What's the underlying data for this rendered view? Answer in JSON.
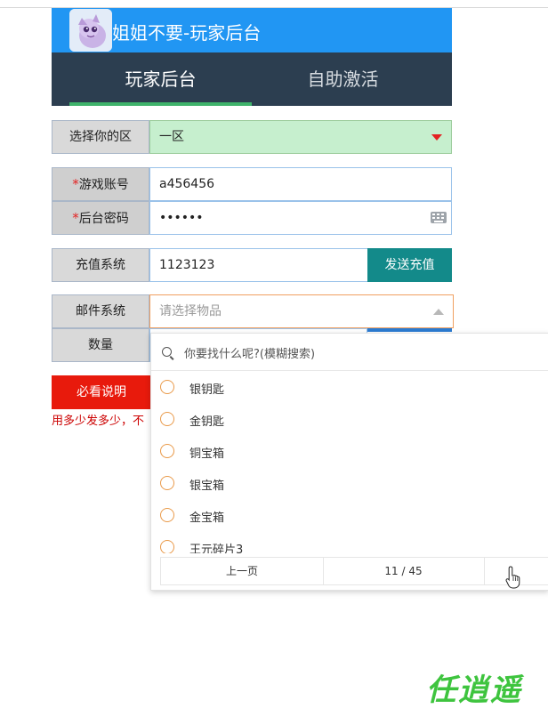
{
  "header": {
    "title": "姐姐不要-玩家后台",
    "avatar_icon": "pony-avatar-icon"
  },
  "tabs": [
    {
      "label": "玩家后台",
      "active": true
    },
    {
      "label": "自助激活",
      "active": false
    }
  ],
  "form": {
    "server": {
      "label": "选择你的区",
      "value": "一区"
    },
    "account": {
      "required_mark": "*",
      "label": "游戏账号",
      "value": "a456456"
    },
    "password": {
      "required_mark": "*",
      "label": "后台密码",
      "value": "••••••"
    },
    "recharge": {
      "label": "充值系统",
      "value": "1123123",
      "button": "发送充值"
    },
    "mail": {
      "label": "邮件系统",
      "placeholder": "请选择物品"
    },
    "quantity": {
      "label": "数量",
      "value": ""
    },
    "must_read_button": "必看说明",
    "notice": "用多少发多少，不"
  },
  "dropdown": {
    "search_placeholder": "你要找什么呢?(模糊搜索)",
    "items": [
      "银钥匙",
      "金钥匙",
      "铜宝箱",
      "银宝箱",
      "金宝箱",
      "王元碎片3"
    ],
    "pager": {
      "prev": "上一页",
      "page": "11 / 45",
      "next": ""
    }
  },
  "watermark": "任逍遥",
  "colors": {
    "header_blue": "#2196f3",
    "tabs_dark": "#2c3e50",
    "active_underline": "#3fb36b",
    "server_field_green": "#c6efce",
    "send_button_teal": "#138a8a",
    "must_read_red": "#e81a0c",
    "radio_orange": "#e99a4a",
    "watermark_green": "#3ec43e"
  }
}
